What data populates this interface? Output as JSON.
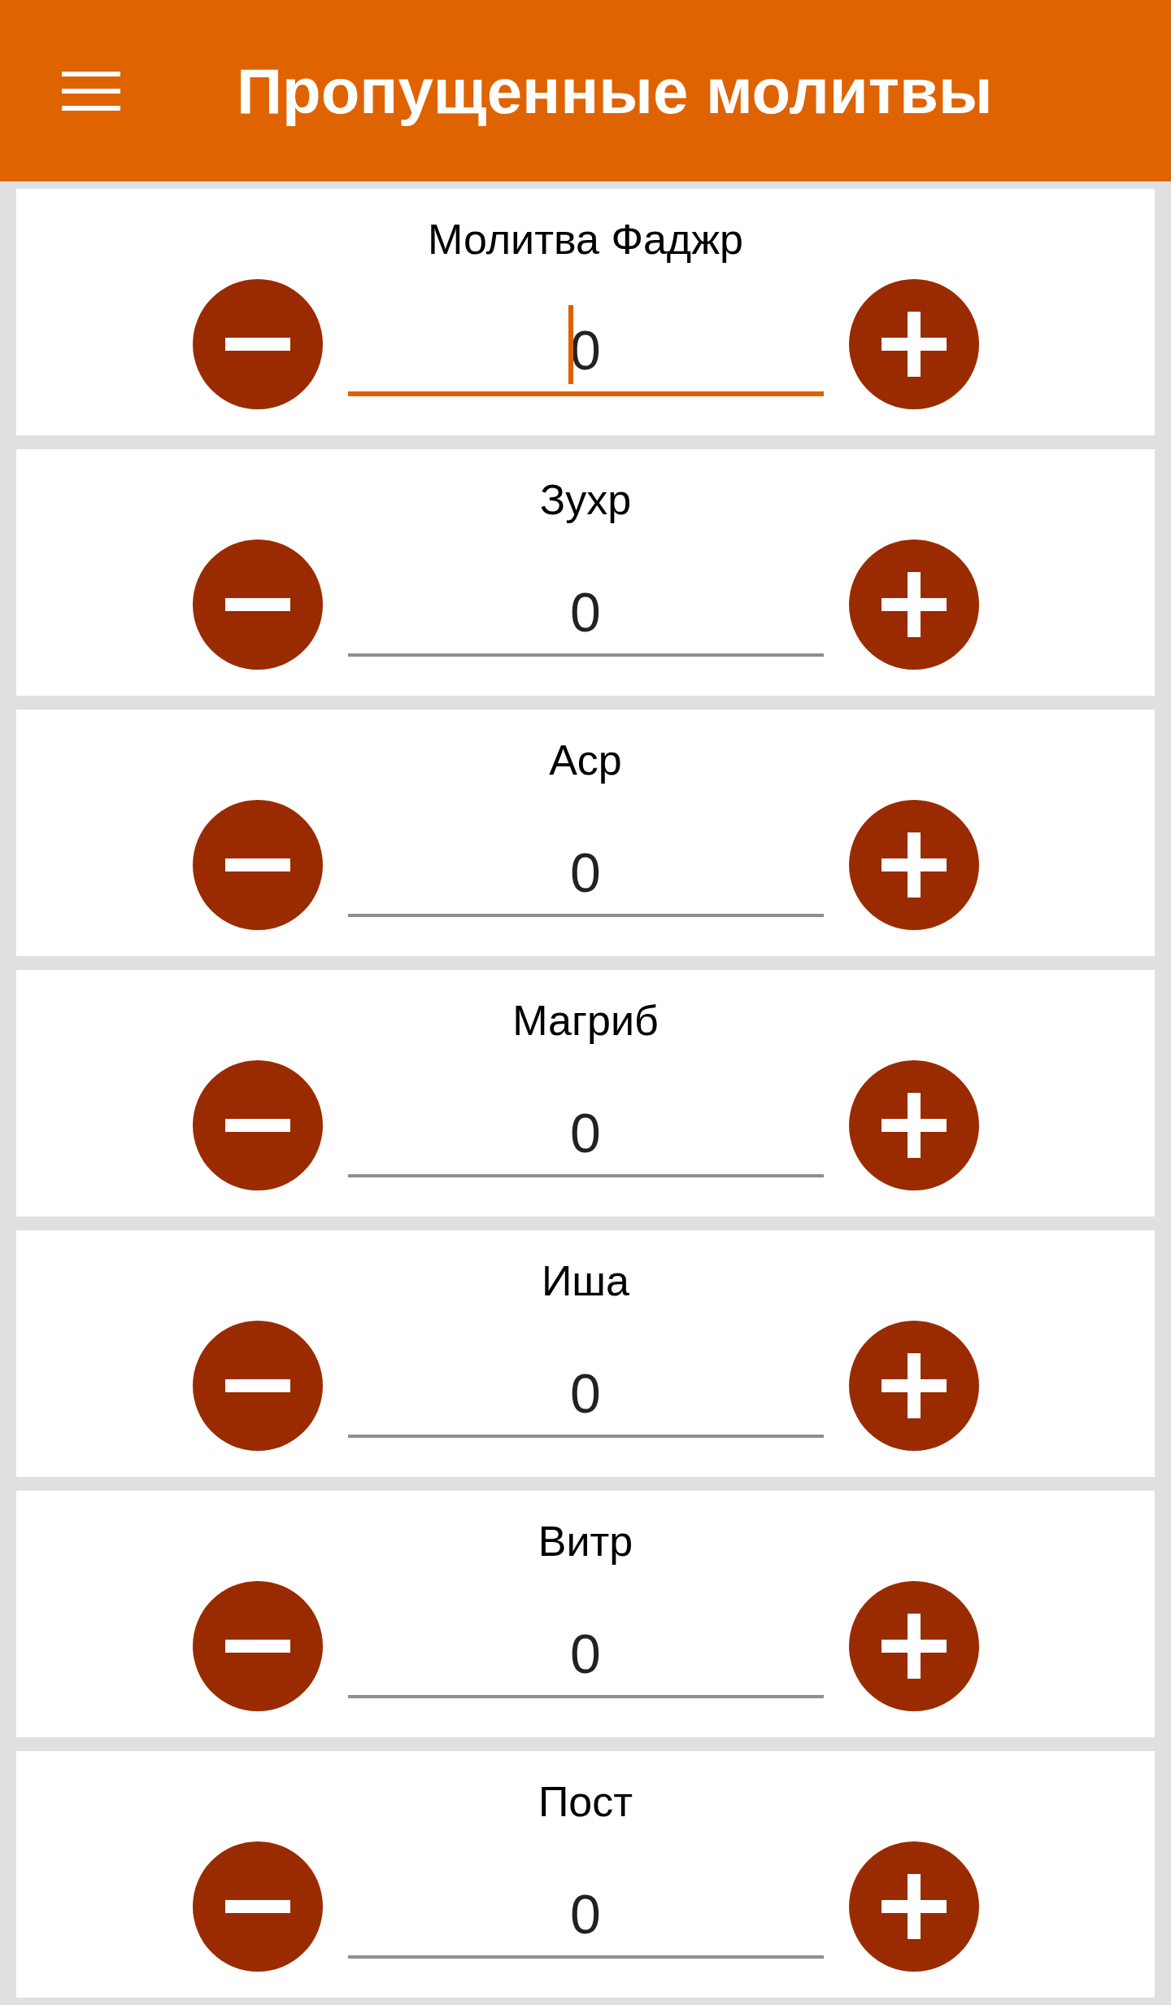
{
  "app_bar": {
    "title": "Пропущенные молитвы"
  },
  "counters": [
    {
      "label": "Молитва Фаджр",
      "value": "0",
      "focused": true
    },
    {
      "label": "Зухр",
      "value": "0",
      "focused": false
    },
    {
      "label": "Аср",
      "value": "0",
      "focused": false
    },
    {
      "label": "Магриб",
      "value": "0",
      "focused": false
    },
    {
      "label": "Иша",
      "value": "0",
      "focused": false
    },
    {
      "label": "Витр",
      "value": "0",
      "focused": false
    },
    {
      "label": "Пост",
      "value": "0",
      "focused": false
    }
  ]
}
